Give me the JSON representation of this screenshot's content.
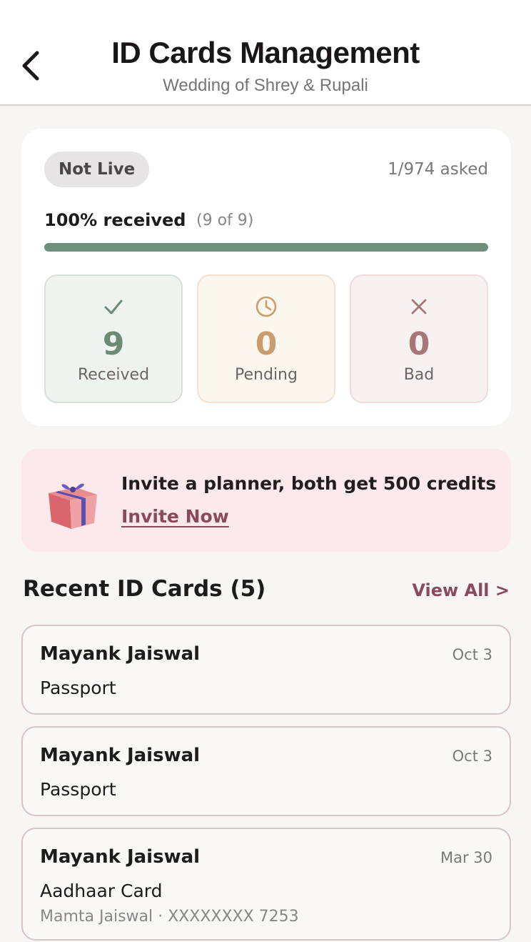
{
  "header": {
    "title": "ID Cards Management",
    "subtitle": "Wedding of Shrey & Rupali",
    "back_icon": "chevron-left-icon"
  },
  "summary": {
    "status_badge": "Not Live",
    "asked": "1/974 asked",
    "progress_label": "100% received",
    "progress_sub": "(9 of 9)",
    "progress_fraction": 1.0,
    "progress_color": "#6e8f7c",
    "stats": [
      {
        "icon": "check-icon",
        "value": "9",
        "label": "Received",
        "color": "#6b8b77"
      },
      {
        "icon": "clock-icon",
        "value": "0",
        "label": "Pending",
        "color": "#c99e6e"
      },
      {
        "icon": "x-icon",
        "value": "0",
        "label": "Bad",
        "color": "#a77676"
      }
    ]
  },
  "promo": {
    "icon": "gift-icon",
    "text": "Invite a planner, both get 500 credits",
    "link": "Invite Now"
  },
  "recent": {
    "title": "Recent ID Cards (5)",
    "view_all": "View All >",
    "items": [
      {
        "name": "Mayank Jaiswal",
        "date": "Oct 3",
        "doc": "Passport"
      },
      {
        "name": "Mayank Jaiswal",
        "date": "Oct 3",
        "doc": "Passport"
      },
      {
        "name": "Mayank Jaiswal",
        "date": "Mar 30",
        "doc": "Aadhaar Card",
        "meta": "Mamta Jaiswal  ·  XXXXXXXX 7253"
      }
    ]
  },
  "colors": {
    "accent": "#8b4a5c",
    "promo_bg": "#fbe9ec"
  }
}
